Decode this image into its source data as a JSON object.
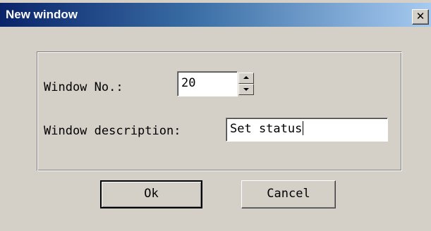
{
  "window": {
    "title": "New window",
    "close_glyph": "✕"
  },
  "form": {
    "window_no_label": "Window No.:",
    "window_no_value": "20",
    "description_label": "Window description:",
    "description_value": "Set status"
  },
  "buttons": {
    "ok_label": "Ok",
    "cancel_label": "Cancel"
  },
  "icons": [
    "close-icon",
    "spin-up-icon",
    "spin-down-icon"
  ],
  "colors": {
    "titlebar_start": "#0a246a",
    "titlebar_end": "#a6caf0",
    "face": "#d4d0c8"
  }
}
